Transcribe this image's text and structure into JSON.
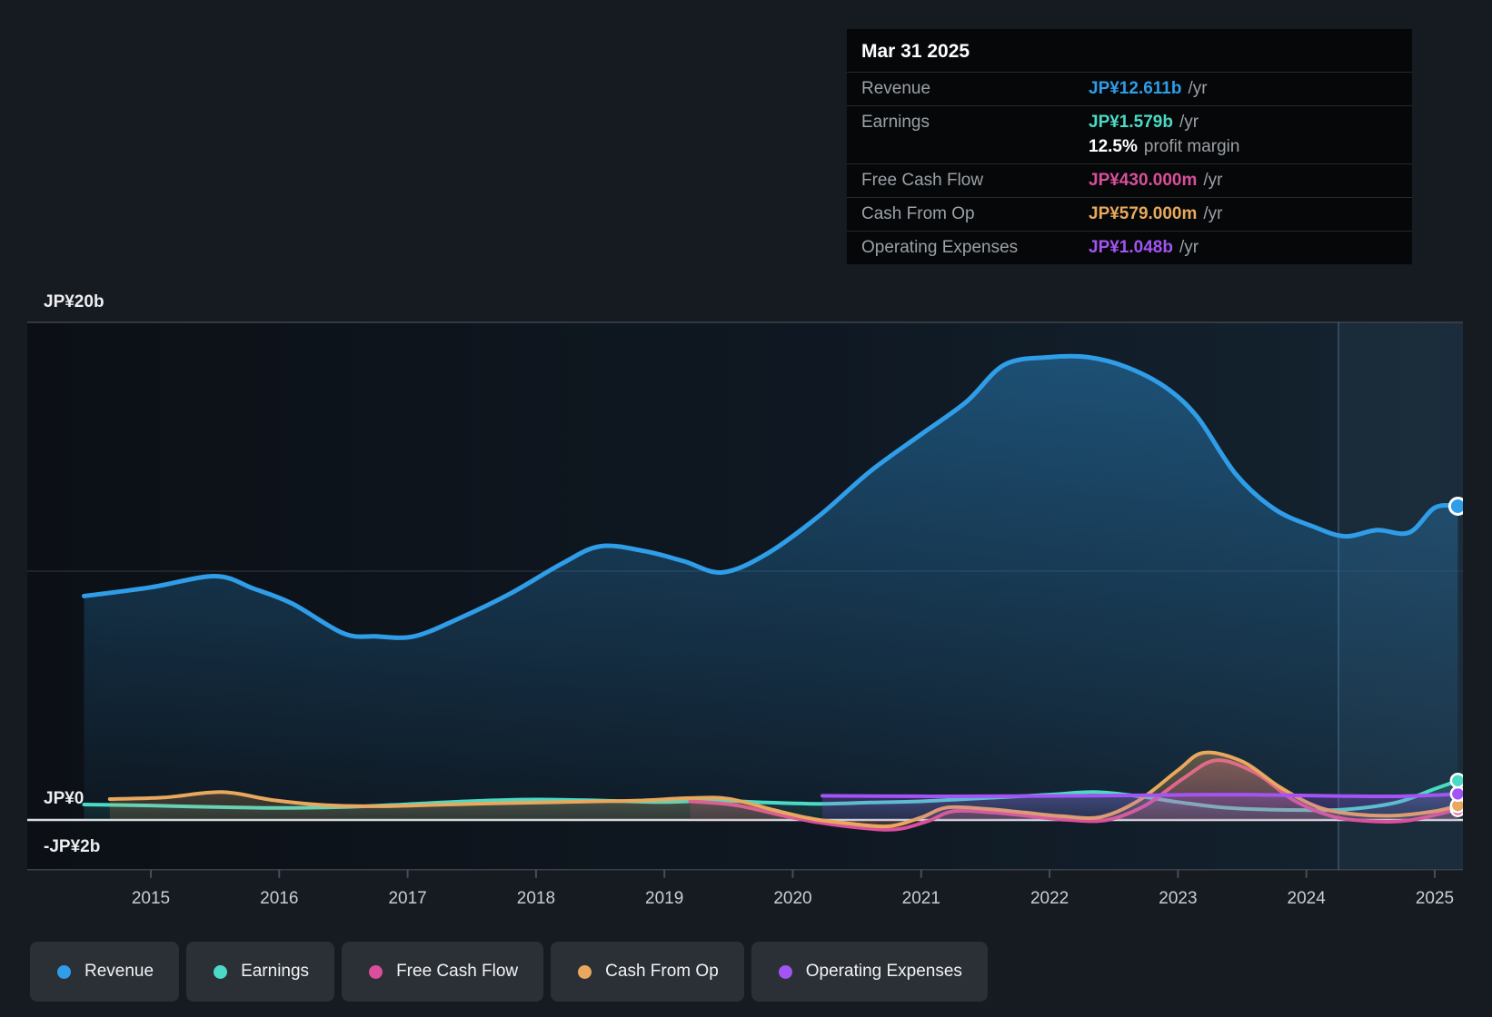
{
  "tooltip": {
    "date": "Mar 31 2025",
    "rows": [
      {
        "label": "Revenue",
        "value": "JP¥12.611b",
        "unit": "/yr",
        "color_key": "revenue"
      },
      {
        "label": "Earnings",
        "value": "JP¥1.579b",
        "unit": "/yr",
        "color_key": "earnings"
      },
      {
        "label": "Free Cash Flow",
        "value": "JP¥430.000m",
        "unit": "/yr",
        "color_key": "free_cash_flow"
      },
      {
        "label": "Cash From Op",
        "value": "JP¥579.000m",
        "unit": "/yr",
        "color_key": "cash_from_op"
      },
      {
        "label": "Operating Expenses",
        "value": "JP¥1.048b",
        "unit": "/yr",
        "color_key": "operating_expenses"
      }
    ],
    "profit_margin": {
      "value": "12.5%",
      "text": "profit margin"
    }
  },
  "legend": {
    "items": [
      {
        "label": "Revenue",
        "color_key": "revenue"
      },
      {
        "label": "Earnings",
        "color_key": "earnings"
      },
      {
        "label": "Free Cash Flow",
        "color_key": "free_cash_flow"
      },
      {
        "label": "Cash From Op",
        "color_key": "cash_from_op"
      },
      {
        "label": "Operating Expenses",
        "color_key": "operating_expenses"
      }
    ]
  },
  "colors": {
    "revenue": "#2F9DE8",
    "earnings": "#4BDAC6",
    "free_cash_flow": "#DA4F9B",
    "cash_from_op": "#E8A85E",
    "operating_expenses": "#A254F4",
    "zero_line": "#D9DDE2",
    "grid_line": "#3A414A",
    "axis_text": "#C9CED4",
    "y_label_text": "#ECEEF0",
    "tooltip_label": "#9BA1A7",
    "page_background": "#161A21",
    "legend_pill_background": "#2B2F36",
    "tooltip_background": "#050708"
  },
  "chart_data": {
    "type": "line",
    "title": "",
    "x_unit": "fiscal year",
    "x_ticks": [
      "2015",
      "2016",
      "2017",
      "2018",
      "2019",
      "2020",
      "2021",
      "2022",
      "2023",
      "2024",
      "2025"
    ],
    "y_ticks": [
      {
        "label": "JP¥20b",
        "value": 20
      },
      {
        "label": "JP¥0",
        "value": 0
      },
      {
        "label": "-JP¥2b",
        "value": -2
      }
    ],
    "ylim": [
      -2,
      20.2
    ],
    "xlim": [
      2014.45,
      2025.25
    ],
    "grid": true,
    "value_unit": "JP¥ billions",
    "highlight_band": {
      "from_year": 2024.25,
      "to_year": 2025.25
    },
    "end_markers": true,
    "legend_position": "bottom",
    "series": [
      {
        "name": "Revenue",
        "key": "revenue",
        "end_value_b": 12.611,
        "points": [
          [
            2014.48,
            9.0
          ],
          [
            2015,
            9.35
          ],
          [
            2015.5,
            9.8
          ],
          [
            2015.8,
            9.3
          ],
          [
            2016.1,
            8.7
          ],
          [
            2016.5,
            7.5
          ],
          [
            2016.75,
            7.38
          ],
          [
            2017.05,
            7.38
          ],
          [
            2017.4,
            8.1
          ],
          [
            2017.8,
            9.1
          ],
          [
            2018.2,
            10.3
          ],
          [
            2018.5,
            11.0
          ],
          [
            2018.85,
            10.8
          ],
          [
            2019.15,
            10.4
          ],
          [
            2019.45,
            9.95
          ],
          [
            2019.8,
            10.7
          ],
          [
            2020.2,
            12.2
          ],
          [
            2020.6,
            14.0
          ],
          [
            2021.0,
            15.5
          ],
          [
            2021.35,
            16.8
          ],
          [
            2021.65,
            18.3
          ],
          [
            2022.0,
            18.6
          ],
          [
            2022.3,
            18.6
          ],
          [
            2022.6,
            18.2
          ],
          [
            2022.9,
            17.4
          ],
          [
            2023.15,
            16.2
          ],
          [
            2023.45,
            13.9
          ],
          [
            2023.75,
            12.5
          ],
          [
            2024.05,
            11.8
          ],
          [
            2024.3,
            11.4
          ],
          [
            2024.55,
            11.65
          ],
          [
            2024.8,
            11.55
          ],
          [
            2025.0,
            12.55
          ],
          [
            2025.18,
            12.611
          ]
        ]
      },
      {
        "name": "Earnings",
        "key": "earnings",
        "end_value_b": 1.579,
        "points": [
          [
            2014.48,
            0.62
          ],
          [
            2015,
            0.58
          ],
          [
            2015.5,
            0.52
          ],
          [
            2016,
            0.48
          ],
          [
            2016.5,
            0.52
          ],
          [
            2017,
            0.63
          ],
          [
            2017.5,
            0.76
          ],
          [
            2018,
            0.82
          ],
          [
            2018.5,
            0.78
          ],
          [
            2019,
            0.72
          ],
          [
            2019.4,
            0.78
          ],
          [
            2019.8,
            0.7
          ],
          [
            2020.2,
            0.65
          ],
          [
            2020.6,
            0.7
          ],
          [
            2021,
            0.75
          ],
          [
            2021.5,
            0.88
          ],
          [
            2022,
            1.02
          ],
          [
            2022.35,
            1.12
          ],
          [
            2022.7,
            0.95
          ],
          [
            2023,
            0.72
          ],
          [
            2023.4,
            0.48
          ],
          [
            2023.9,
            0.4
          ],
          [
            2024.3,
            0.42
          ],
          [
            2024.7,
            0.7
          ],
          [
            2025,
            1.25
          ],
          [
            2025.18,
            1.579
          ]
        ]
      },
      {
        "name": "Free Cash Flow",
        "key": "free_cash_flow",
        "end_value_b": 0.43,
        "points": [
          [
            2019.2,
            0.75
          ],
          [
            2019.55,
            0.6
          ],
          [
            2019.9,
            0.2
          ],
          [
            2020.2,
            -0.1
          ],
          [
            2020.5,
            -0.3
          ],
          [
            2020.8,
            -0.38
          ],
          [
            2021.05,
            -0.05
          ],
          [
            2021.25,
            0.35
          ],
          [
            2021.55,
            0.3
          ],
          [
            2021.85,
            0.15
          ],
          [
            2022.15,
            0.0
          ],
          [
            2022.45,
            0.0
          ],
          [
            2022.75,
            0.6
          ],
          [
            2023.05,
            1.7
          ],
          [
            2023.3,
            2.4
          ],
          [
            2023.6,
            1.9
          ],
          [
            2023.9,
            0.8
          ],
          [
            2024.2,
            0.15
          ],
          [
            2024.5,
            -0.05
          ],
          [
            2024.8,
            -0.02
          ],
          [
            2025.18,
            0.43
          ]
        ]
      },
      {
        "name": "Cash From Op",
        "key": "cash_from_op",
        "end_value_b": 0.579,
        "points": [
          [
            2014.68,
            0.84
          ],
          [
            2015.1,
            0.9
          ],
          [
            2015.55,
            1.12
          ],
          [
            2015.95,
            0.8
          ],
          [
            2016.35,
            0.6
          ],
          [
            2016.8,
            0.55
          ],
          [
            2017.3,
            0.62
          ],
          [
            2017.8,
            0.68
          ],
          [
            2018.3,
            0.73
          ],
          [
            2018.8,
            0.78
          ],
          [
            2019.2,
            0.88
          ],
          [
            2019.5,
            0.85
          ],
          [
            2019.85,
            0.4
          ],
          [
            2020.15,
            0.05
          ],
          [
            2020.45,
            -0.15
          ],
          [
            2020.75,
            -0.25
          ],
          [
            2021.0,
            0.1
          ],
          [
            2021.2,
            0.5
          ],
          [
            2021.5,
            0.45
          ],
          [
            2021.8,
            0.3
          ],
          [
            2022.1,
            0.15
          ],
          [
            2022.4,
            0.12
          ],
          [
            2022.7,
            0.8
          ],
          [
            2023.0,
            2.0
          ],
          [
            2023.2,
            2.7
          ],
          [
            2023.5,
            2.35
          ],
          [
            2023.8,
            1.3
          ],
          [
            2024.1,
            0.5
          ],
          [
            2024.4,
            0.22
          ],
          [
            2024.7,
            0.18
          ],
          [
            2025.0,
            0.35
          ],
          [
            2025.18,
            0.579
          ]
        ]
      },
      {
        "name": "Operating Expenses",
        "key": "operating_expenses",
        "end_value_b": 1.048,
        "points": [
          [
            2020.23,
            0.97
          ],
          [
            2020.7,
            0.96
          ],
          [
            2021.2,
            0.95
          ],
          [
            2021.7,
            0.96
          ],
          [
            2022.2,
            0.97
          ],
          [
            2022.7,
            0.99
          ],
          [
            2023.1,
            1.01
          ],
          [
            2023.5,
            1.02
          ],
          [
            2023.9,
            0.99
          ],
          [
            2024.3,
            0.96
          ],
          [
            2024.7,
            0.95
          ],
          [
            2025.0,
            1.0
          ],
          [
            2025.18,
            1.048
          ]
        ]
      }
    ]
  }
}
